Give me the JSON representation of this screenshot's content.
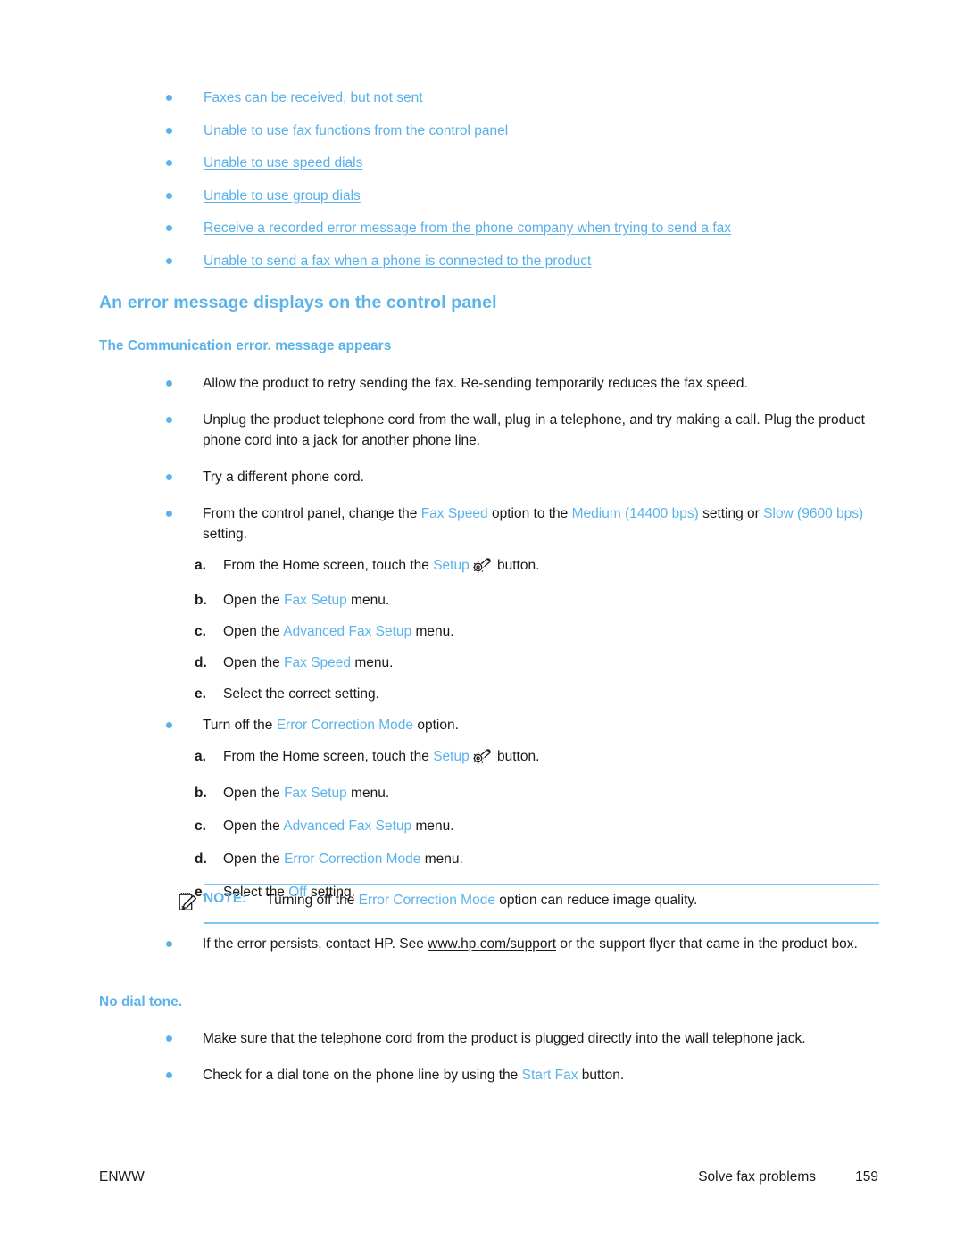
{
  "colors": {
    "link_blue": "#58b0e8",
    "heading_blue": "#5bb3ea",
    "rule_blue": "#7ec6f3",
    "body_text": "#1a1a1a",
    "page_background": "#ffffff"
  },
  "toc_links": [
    {
      "label": "Faxes can be received, but not sent"
    },
    {
      "label": "Unable to use fax functions from the control panel"
    },
    {
      "label": "Unable to use speed dials"
    },
    {
      "label": "Unable to use group dials"
    },
    {
      "label": "Receive a recorded error message from the phone company when trying to send a fax"
    },
    {
      "label": "Unable to send a fax when a phone is connected to the product"
    }
  ],
  "section": {
    "heading": "An error message displays on the control panel",
    "subheading_1": "The Communication error. message appears",
    "subheading_2": "No dial tone."
  },
  "bullets_group_1": {
    "b1": "Allow the product to retry sending the fax. Re-sending temporarily reduces the fax speed.",
    "b2": "Unplug the product telephone cord from the wall, plug in a telephone, and try making a call. Plug the product phone cord into a jack for another phone line.",
    "b3": "Try a different phone cord.",
    "b4": {
      "part1": "From the control panel, change the ",
      "ui1": "Fax Speed",
      "part2": " option to the ",
      "ui2": "Medium (14400 bps)",
      "part3": " setting or ",
      "ui3": "Slow (9600 bps)",
      "part4": " setting."
    }
  },
  "steps_fax_speed": {
    "a": {
      "letter": "a.",
      "part1": "From the Home screen, touch the ",
      "ui": "Setup",
      "icon": "settings-gear-wrench-icon",
      "part2": " button."
    },
    "b": {
      "letter": "b.",
      "part1": "Open the ",
      "ui": "Fax Setup",
      "part2": " menu."
    },
    "c": {
      "letter": "c.",
      "part1": "Open the ",
      "ui": "Advanced Fax Setup",
      "part2": " menu."
    },
    "d": {
      "letter": "d.",
      "part1": "Open the ",
      "ui": "Fax Speed",
      "part2": " menu."
    },
    "e": {
      "letter": "e.",
      "part1": "Select the correct setting.",
      "ui": "",
      "part2": ""
    }
  },
  "bullet_ecm": {
    "part1": "Turn off the ",
    "ui": "Error Correction Mode",
    "part2": " option."
  },
  "steps_ecm": {
    "a": {
      "letter": "a.",
      "part1": "From the Home screen, touch the ",
      "ui": "Setup",
      "icon": "settings-gear-wrench-icon",
      "part2": " button."
    },
    "b": {
      "letter": "b.",
      "part1": "Open the ",
      "ui": "Fax Setup",
      "part2": " menu."
    },
    "c": {
      "letter": "c.",
      "part1": "Open the ",
      "ui": "Advanced Fax Setup",
      "part2": " menu."
    },
    "d": {
      "letter": "d.",
      "part1": "Open the ",
      "ui": "Error Correction Mode",
      "part2": " menu."
    },
    "e": {
      "letter": "e.",
      "part1": "Select the ",
      "ui": "Off",
      "part2": " setting."
    }
  },
  "note": {
    "icon": "note-pad-pencil-icon",
    "label": "NOTE:",
    "part1": "Turning off the ",
    "ui": "Error Correction Mode",
    "part2": " option can reduce image quality."
  },
  "bullet_support": {
    "part1": "If the error persists, contact HP. See ",
    "url": "www.hp.com/support",
    "part2": " or the support flyer that came in the product box."
  },
  "bullets_group_2": {
    "b1": "Make sure that the telephone cord from the product is plugged directly into the wall telephone jack.",
    "b2": {
      "part1": "Check for a dial tone on the phone line by using the ",
      "ui": "Start Fax",
      "part2": " button."
    }
  },
  "footer": {
    "left": "ENWW",
    "section": "Solve fax problems",
    "page": "159"
  }
}
